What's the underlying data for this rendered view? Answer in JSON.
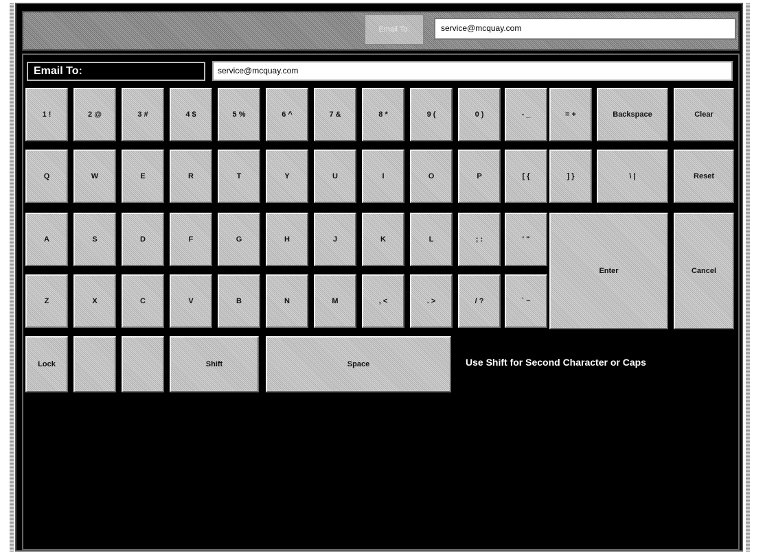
{
  "toolbar": {
    "email_to_button": "Email To:",
    "recipient_value": "service@mcquay.com"
  },
  "form": {
    "email_to_label": "Email To:",
    "email_value": "service@mcquay.com"
  },
  "keyboard": {
    "row1": [
      "1 !",
      "2 @",
      "3 #",
      "4 $",
      "5 %",
      "6 ^",
      "7 &",
      "8 *",
      "9 (",
      "0 )",
      "- _",
      "= +",
      "Backspace",
      "Clear"
    ],
    "row2": [
      "Q",
      "W",
      "E",
      "R",
      "T",
      "Y",
      "U",
      "I",
      "O",
      "P",
      "[ {",
      "] }",
      "\\ |",
      "Reset"
    ],
    "row3": [
      "A",
      "S",
      "D",
      "F",
      "G",
      "H",
      "J",
      "K",
      "L",
      "; :",
      "' \""
    ],
    "row4": [
      "Z",
      "X",
      "C",
      "V",
      "B",
      "N",
      "M",
      ", <",
      ". >",
      "/ ?",
      "` ~"
    ],
    "enter": "Enter",
    "cancel": "Cancel",
    "row5": [
      "Lock",
      "",
      "",
      "Shift",
      "Space"
    ]
  },
  "hint": "Use Shift for Second Character or Caps"
}
